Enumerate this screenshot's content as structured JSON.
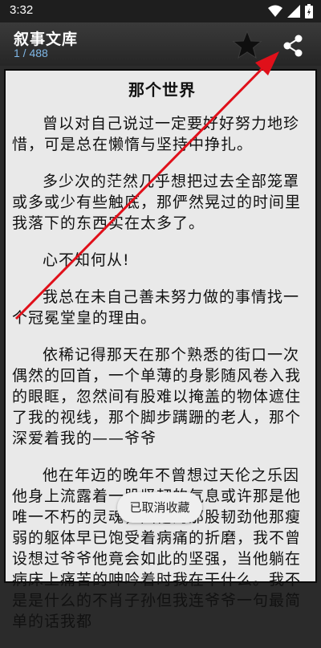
{
  "status_bar": {
    "time": "3:32"
  },
  "app_bar": {
    "title": "叙事文库",
    "counter": "1 / 488",
    "favorite_icon": "star-icon",
    "share_icon": "share-icon"
  },
  "article": {
    "title": "那个世界",
    "paragraphs": [
      "曾以对自己说过一定要好好努力地珍惜，可是总在懒惰与坚持中挣扎。",
      "多少次的茫然几乎想把过去全部笼罩或多或少有些触底，那俨然晃过的时间里我落下的东西实在太多了。",
      "心不知何从!",
      "我总在未自己善未努力做的事情找一个冠冕堂皇的理由。",
      "依稀记得那天在那个熟悉的街口一次偶然的回首，一个单薄的身影随风卷入我的眼眶，忽然间有股难以掩盖的物体遮住了我的视线，那个脚步蹒跚的老人，那个深爱着我的——爷爷",
      "他在年迈的晚年不曾想过天伦之乐因他身上流露着一股坚韧的气息或许那是他唯一不朽的灵魂，因他的那股韧劲他那瘦弱的躯体早已饱受着病痛的折磨，我不曾设想过爷爷他竟会如此的坚强，当他躺在病床上痛苦的呻吟着时我在干什么。我不是是什么的不肖子孙但我连爷爷一句最简单的话我都"
    ]
  },
  "toast": {
    "text": "已取消收藏"
  },
  "colors": {
    "app_bar": "#2e2e2e",
    "counter": "#7fb7e6",
    "page_bg": "#e9e9e9",
    "annotation_arrow": "#e0101a"
  }
}
